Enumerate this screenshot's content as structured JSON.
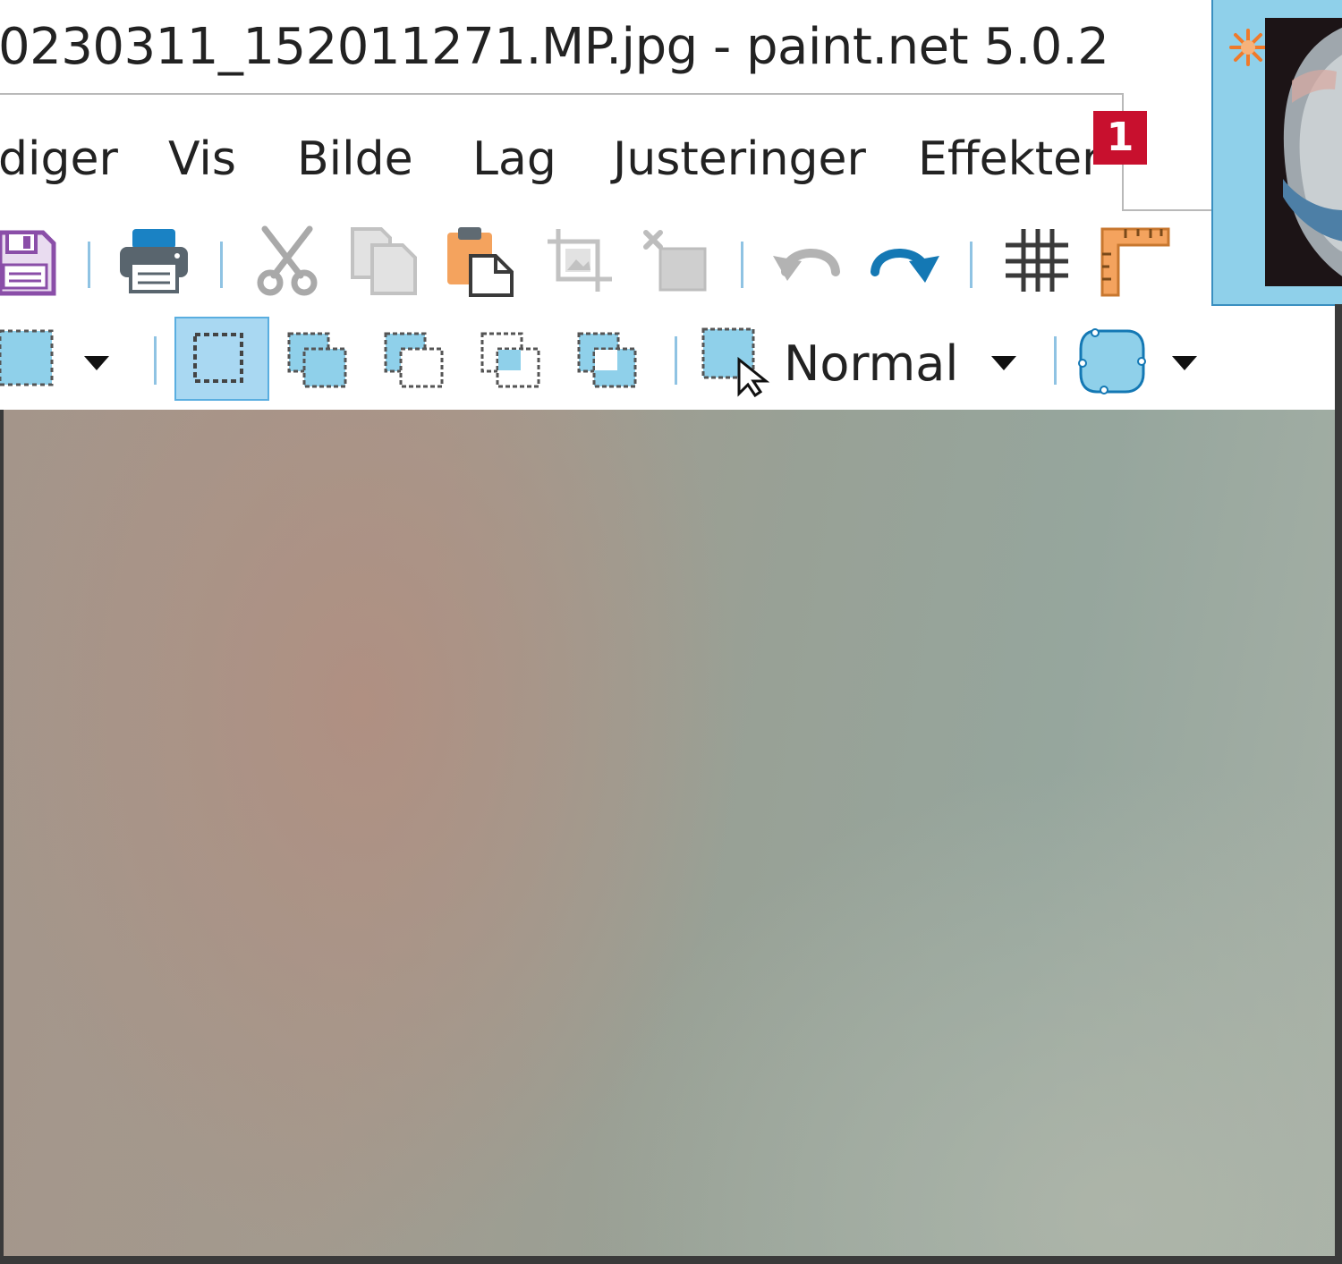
{
  "window": {
    "title": "0230311_152011271.MP.jpg - paint.net 5.0.2"
  },
  "menu": {
    "items": [
      "diger",
      "Vis",
      "Bilde",
      "Lag",
      "Justeringer",
      "Effekter"
    ],
    "badge": "1"
  },
  "toolbar": {
    "icons": [
      "save-icon",
      "print-icon",
      "cut-icon",
      "copy-icon",
      "paste-icon",
      "crop-icon",
      "deselect-icon",
      "undo-icon",
      "redo-icon",
      "grid-icon",
      "ruler-icon"
    ]
  },
  "selection_toolbar": {
    "blend_mode": "Normal",
    "icons": [
      "selection-shape-icon",
      "replace-mode-icon",
      "union-mode-icon",
      "exclude-mode-icon",
      "intersect-mode-icon",
      "xor-mode-icon",
      "selection-cursor-icon",
      "antialias-icon"
    ]
  },
  "colors": {
    "accent": "#8fd0ea",
    "accent_dark": "#1478b4",
    "badge": "#c8102e"
  }
}
